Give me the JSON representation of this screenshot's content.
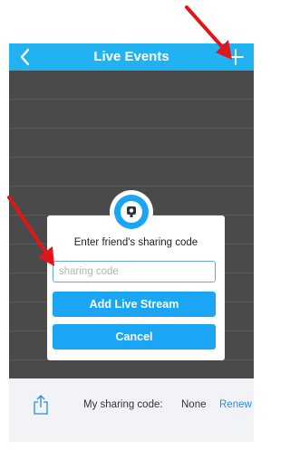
{
  "navbar": {
    "title": "Live Events",
    "back_icon": "chevron-left-icon",
    "add_icon": "plus-icon",
    "color": "#22b2f2"
  },
  "dialog": {
    "icon": "camera-icon",
    "title": "Enter friend's sharing code",
    "input_placeholder": "sharing code",
    "input_value": "",
    "add_button_label": "Add Live Stream",
    "cancel_button_label": "Cancel",
    "button_color": "#1aa5f5"
  },
  "bottom_bar": {
    "share_icon": "share-icon",
    "my_code_label": "My sharing code:",
    "my_code_value": "None",
    "renew_label": "Renew",
    "link_color": "#2d8ae6"
  },
  "annotations": {
    "arrow_color": "#e0161b",
    "arrows": [
      "arrow-to-add-icon",
      "arrow-to-code-input"
    ]
  }
}
